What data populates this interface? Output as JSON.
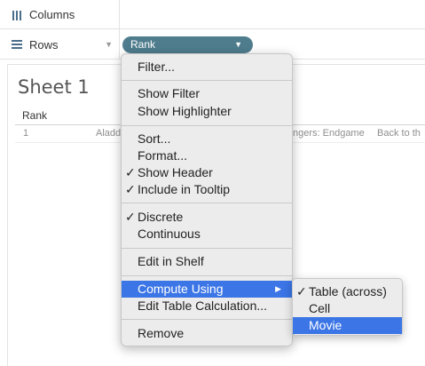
{
  "shelves": {
    "columns_label": "Columns",
    "rows_label": "Rows",
    "rows_pill": "Rank"
  },
  "sheet": {
    "title": "Sheet 1",
    "column_header": "Rank",
    "row": {
      "rank": "1",
      "cell_a": "Aladd",
      "cell_b": "ngers: Endgame",
      "cell_c": "Back to th"
    }
  },
  "menu": {
    "items": [
      {
        "label": "Filter..."
      },
      {
        "label": "Show Filter"
      },
      {
        "label": "Show Highlighter"
      },
      {
        "label": "Sort..."
      },
      {
        "label": "Format..."
      },
      {
        "label": "Show Header",
        "check": "✓"
      },
      {
        "label": "Include in Tooltip",
        "check": "✓"
      },
      {
        "label": "Discrete",
        "check": "✓"
      },
      {
        "label": "Continuous"
      },
      {
        "label": "Edit in Shelf"
      },
      {
        "label": "Compute Using",
        "submenu_arrow": "▶"
      },
      {
        "label": "Edit Table Calculation..."
      },
      {
        "label": "Remove"
      }
    ]
  },
  "submenu": {
    "items": [
      {
        "label": "Table (across)",
        "check": "✓"
      },
      {
        "label": "Cell"
      },
      {
        "label": "Movie"
      }
    ]
  },
  "colors": {
    "pill": "#4f7d8e",
    "highlight": "#3b75e6",
    "menu_bg": "#ececec"
  },
  "icons": {
    "columns": "columns-icon",
    "rows": "rows-icon",
    "dropdown": "caret-down-icon"
  }
}
